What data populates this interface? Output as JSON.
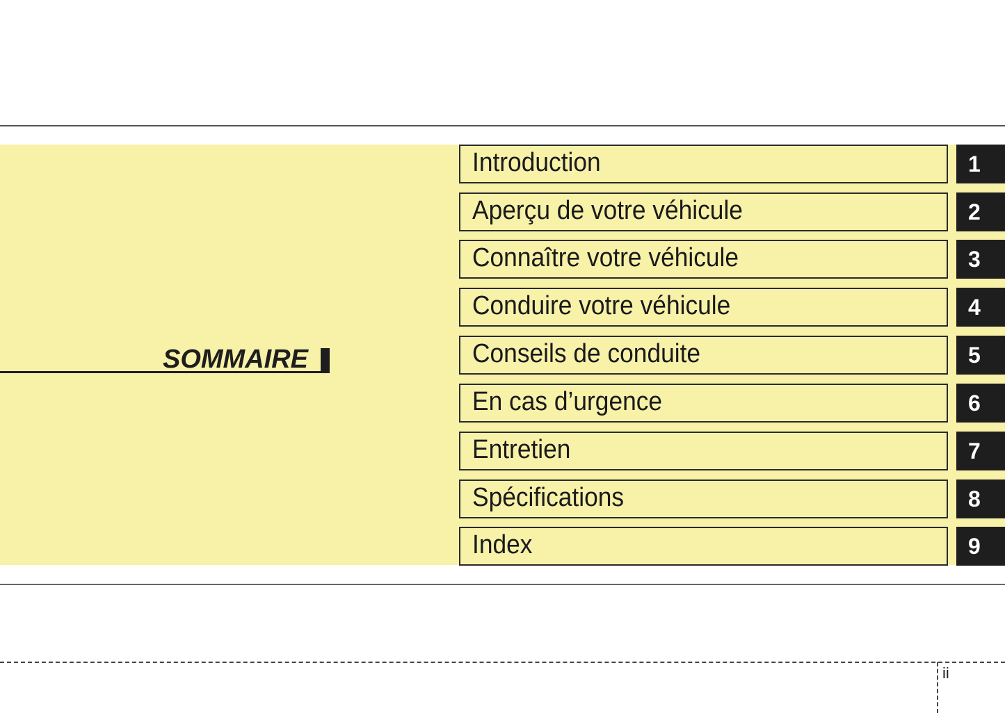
{
  "document": {
    "section_title": "SOMMAIRE",
    "page_number": "ii",
    "colors": {
      "band_background": "#f8f2a9",
      "number_block": "#1e1e1e",
      "number_text": "#ffffff",
      "text": "#1a1a1a"
    }
  },
  "toc": {
    "items": [
      {
        "label": "Introduction",
        "number": "1"
      },
      {
        "label": "Aperçu de votre véhicule",
        "number": "2"
      },
      {
        "label": "Connaître votre véhicule",
        "number": "3"
      },
      {
        "label": "Conduire votre véhicule",
        "number": "4"
      },
      {
        "label": "Conseils de conduite",
        "number": "5"
      },
      {
        "label": "En cas d’urgence",
        "number": "6"
      },
      {
        "label": "Entretien",
        "number": "7"
      },
      {
        "label": "Spécifications",
        "number": "8"
      },
      {
        "label": "Index",
        "number": "9"
      }
    ]
  }
}
